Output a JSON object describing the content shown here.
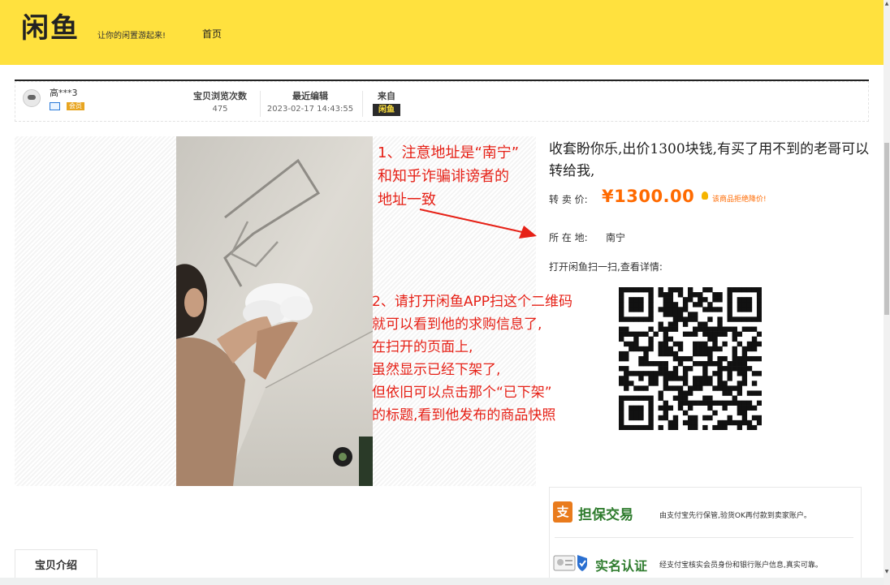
{
  "header": {
    "logo": "闲鱼",
    "slogan": "让你的闲置游起来!",
    "nav_home": "首页",
    "bg_color": "#ffe13e"
  },
  "seller": {
    "username": "高***3",
    "vip_badge": "会员",
    "icons": [
      "avatar",
      "id-verified-icon",
      "vip-badge"
    ]
  },
  "stats": {
    "views_label": "宝贝浏览次数",
    "views_value": "475",
    "edited_label": "最近编辑",
    "edited_value": "2023-02-17 14:43:55",
    "source_label": "来自",
    "source_logo": "闲鱼"
  },
  "annotations": {
    "note1_lines": [
      "1、注意地址是“南宁”",
      "和知乎诈骗诽谤者的",
      "地址一致"
    ],
    "note2_lines": [
      "2、请打开闲鱼APP扫这个二维码",
      "就可以看到他的求购信息了,",
      "在扫开的页面上,",
      "虽然显示已经下架了,",
      "但依旧可以点击那个“已下架”",
      "的标题,看到他发布的商品快照"
    ],
    "color": "#e62117"
  },
  "item": {
    "title": "收套盼你乐,出价1300块钱,有买了用不到的老哥可以转给我,",
    "price_label": "转 卖 价:",
    "price": "¥1300.00",
    "notify_text": "该商品拒绝降价!",
    "location_label": "所 在 地:",
    "location": "南宁",
    "scan_hint": "打开闲鱼扫一扫,查看详情:",
    "price_color": "#ff6a00"
  },
  "trust": {
    "escrow_icon": "支",
    "escrow_title": "担保交易",
    "escrow_desc": "由支付宝先行保管,验货OK再付款到卖家账户。",
    "realname_title": "实名认证",
    "realname_desc": "经支付宝核实会员身份和银行账户信息,真实可靠。",
    "title_color": "#2f7c2e"
  },
  "tabs": {
    "intro": "宝贝介绍"
  },
  "scrollbar": {
    "up": "▲",
    "down": "▼"
  }
}
